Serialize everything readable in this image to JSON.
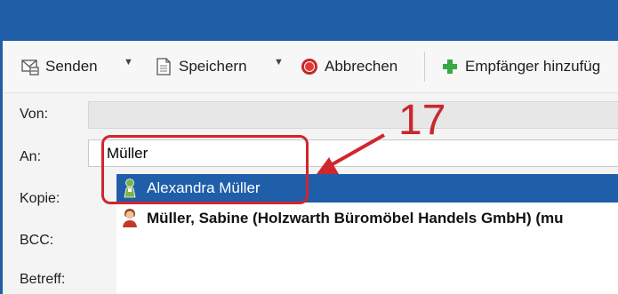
{
  "toolbar": {
    "send_label": "Senden",
    "save_label": "Speichern",
    "cancel_label": "Abbrechen",
    "add_recipient_label": "Empfänger hinzufüg"
  },
  "form": {
    "from_label": "Von:",
    "to_label": "An:",
    "cc_label": "Kopie:",
    "bcc_label": "BCC:",
    "subject_label": "Betreff:",
    "to_value": "Müller"
  },
  "suggestions": [
    {
      "name": "Alexandra Müller",
      "selected": true,
      "icon": "contact-green-icon"
    },
    {
      "name": "Müller, Sabine (Holzwarth Büromöbel Handels GmbH) (mu",
      "selected": false,
      "icon": "contact-person-icon"
    }
  ],
  "annotation": {
    "number": "17",
    "color": "#d0262e"
  },
  "colors": {
    "titlebar": "#1f5fa8",
    "selection": "#1f5ea9",
    "add_icon": "#3aa845"
  }
}
